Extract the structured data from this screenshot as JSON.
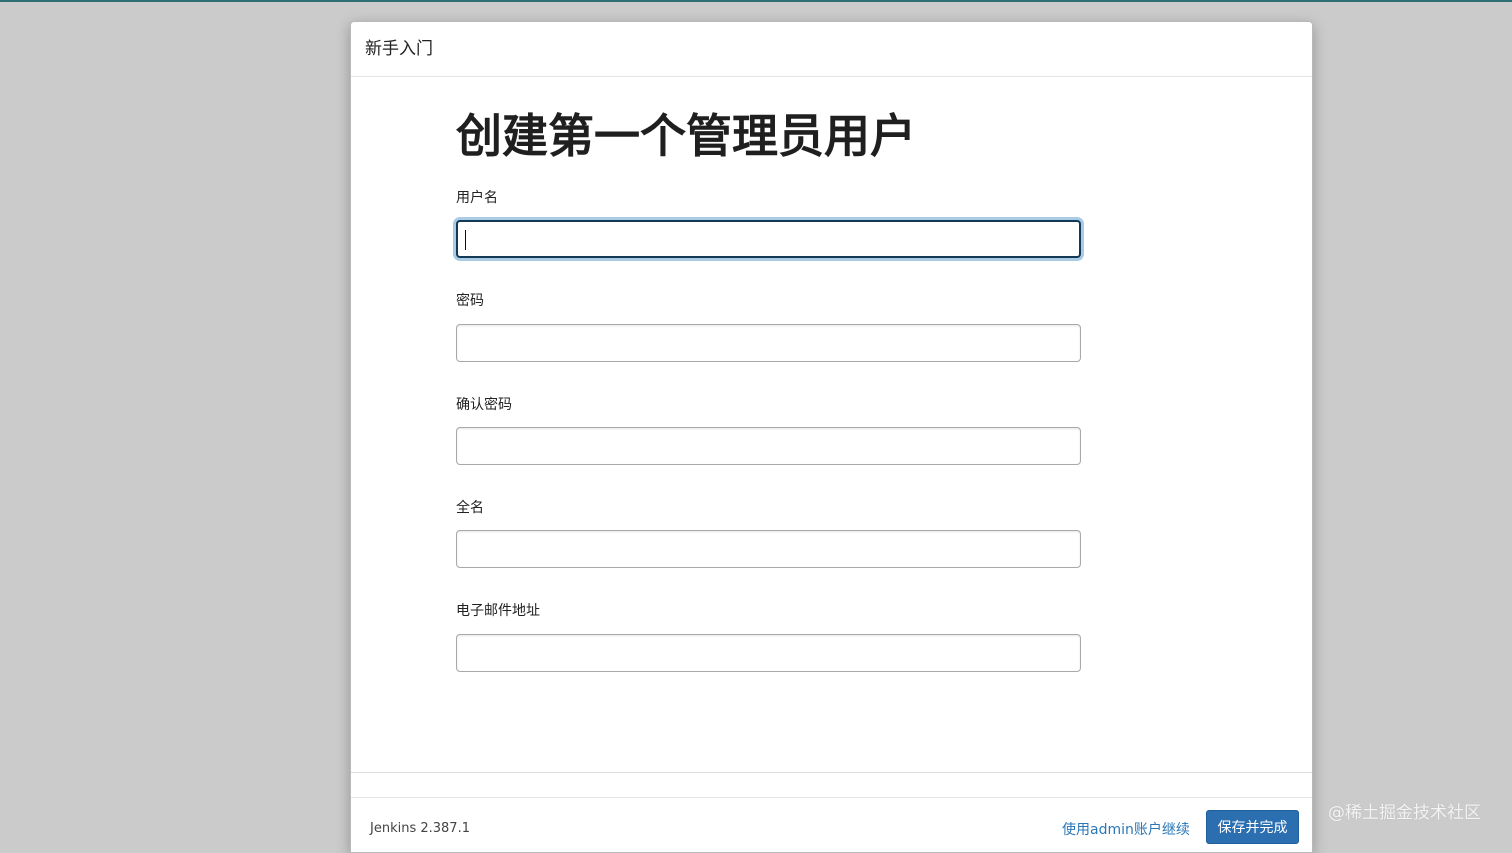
{
  "header": {
    "title": "新手入门"
  },
  "page": {
    "title": "创建第一个管理员用户"
  },
  "fields": [
    {
      "label": "用户名",
      "value": "",
      "placeholder": ""
    },
    {
      "label": "密码",
      "value": "",
      "placeholder": ""
    },
    {
      "label": "确认密码",
      "value": "",
      "placeholder": ""
    },
    {
      "label": "全名",
      "value": "",
      "placeholder": ""
    },
    {
      "label": "电子邮件地址",
      "value": "",
      "placeholder": ""
    }
  ],
  "footer": {
    "version": "Jenkins 2.387.1",
    "continue_as_admin": "使用admin账户继续",
    "save_label": "保存并完成"
  },
  "watermark": "@稀土掘金技术社区",
  "colors": {
    "background": "#cbcbcb",
    "primary_button": "#2b6fb1",
    "link": "#2a77b8",
    "focus_ring": "#a9cbe6"
  }
}
